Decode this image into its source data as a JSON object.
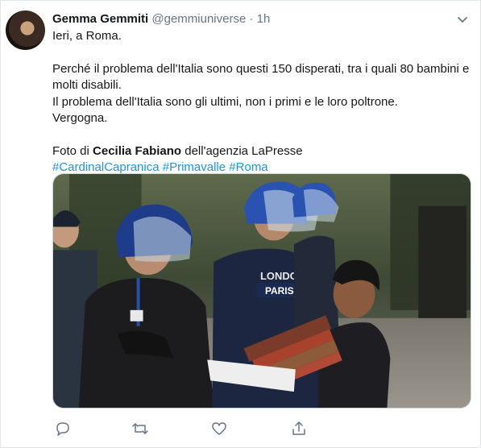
{
  "tweet": {
    "author_name": "Gemma Gemmiti",
    "handle": "@gemmiuniverse",
    "separator": "·",
    "time": "1h",
    "lines": [
      "Ieri, a Roma.",
      "Perché il problema dell'Italia sono questi 150 disperati, tra i quali 80 bambini e molti disabili.",
      "Il problema dell'Italia sono gli ultimi, non i primi e le loro poltrone.",
      "Vergogna."
    ],
    "credit_prefix": "Foto di ",
    "credit_name": "Cecilia Fabiano",
    "credit_suffix": " dell'agenzia LaPresse",
    "hashtags": [
      "#CardinalCapranica",
      "#Primavalle",
      "#Roma"
    ]
  },
  "media": {
    "shirt_text_1": "LONDON",
    "shirt_text_2": "PARIS"
  },
  "icons": {
    "caret": "chevron-down-icon",
    "reply": "reply-icon",
    "retweet": "retweet-icon",
    "like": "like-icon",
    "share": "share-icon"
  },
  "colors": {
    "link": "#1b95e0",
    "muted": "#657786",
    "text": "#14171a"
  }
}
